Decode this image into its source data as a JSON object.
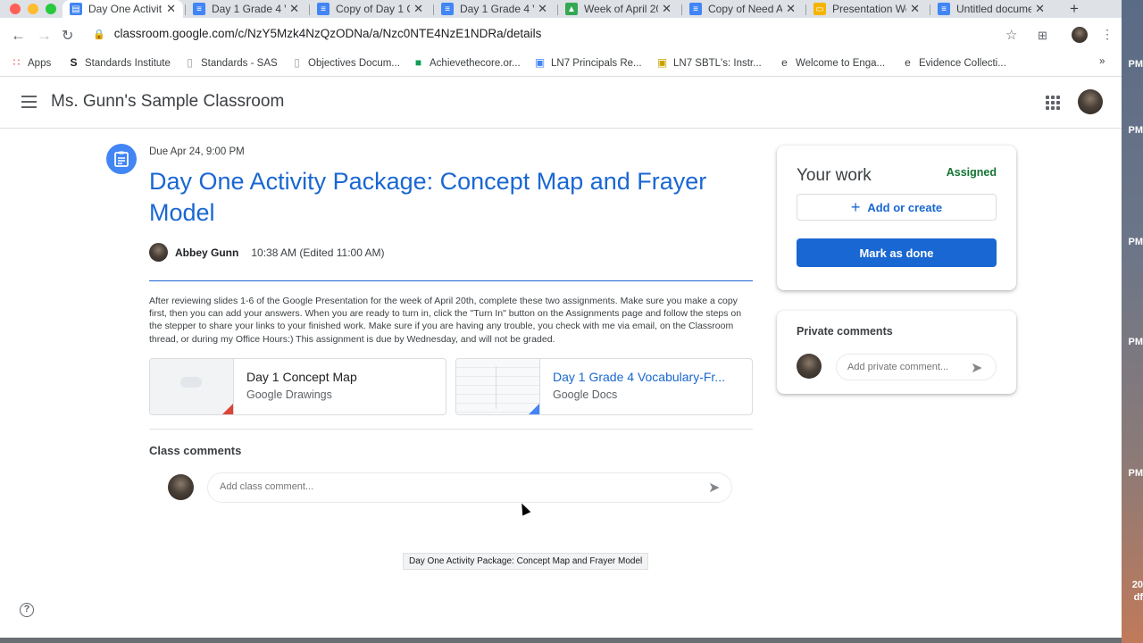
{
  "browser": {
    "tabs": [
      {
        "label": "Day One Activit",
        "icon": "classroom-icon",
        "color": "#4285f4",
        "active": true
      },
      {
        "label": "Day 1 Grade 4 V",
        "icon": "docs-icon",
        "color": "#4285f4"
      },
      {
        "label": "Copy of Day 1 C",
        "icon": "docs-icon",
        "color": "#4285f4"
      },
      {
        "label": "Day 1 Grade 4 V",
        "icon": "docs-icon",
        "color": "#4285f4"
      },
      {
        "label": "Week of April 20",
        "icon": "drive-icon",
        "color": "#34a853"
      },
      {
        "label": "Copy of Need A",
        "icon": "docs-icon",
        "color": "#4285f4"
      },
      {
        "label": "Presentation We",
        "icon": "slides-icon",
        "color": "#f4b400"
      },
      {
        "label": "Untitled docume",
        "icon": "docs-icon",
        "color": "#4285f4"
      }
    ],
    "new_tab": "+",
    "url": "classroom.google.com/c/NzY5Mzk4NzQzODNa/a/Nzc0NTE4NzE1NDRa/details",
    "bookmarks": [
      {
        "label": "Apps",
        "icon": "apps-grid-icon"
      },
      {
        "label": "Standards Institute",
        "icon": "s-logo-icon"
      },
      {
        "label": "Standards - SAS",
        "icon": "page-icon"
      },
      {
        "label": "Objectives Docum...",
        "icon": "page-icon"
      },
      {
        "label": "Achievethecore.or...",
        "icon": "green-square-icon"
      },
      {
        "label": "LN7 Principals Re...",
        "icon": "classroom-icon"
      },
      {
        "label": "LN7 SBTL's: Instr...",
        "icon": "yellow-board-icon"
      },
      {
        "label": "Welcome to Enga...",
        "icon": "engage-icon"
      },
      {
        "label": "Evidence Collecti...",
        "icon": "engage-icon"
      }
    ],
    "bookmarks_more": "»"
  },
  "appbar": {
    "class_name": "Ms. Gunn's Sample Classroom"
  },
  "assignment": {
    "due": "Due Apr 24, 9:00 PM",
    "title": "Day One Activity Package: Concept Map and Frayer Model",
    "author": "Abbey Gunn",
    "time": "10:38 AM (Edited 11:00 AM)",
    "description": "After reviewing slides 1-6 of the Google Presentation for the week of April 20th, complete these two assignments. Make sure you make a copy first, then you can add your answers. When you are ready to turn in, click the \"Turn In\" button on the Assignments page and follow the steps on the stepper to share your links to your finished work. Make sure if you are having any trouble, you check with me via email, on the Classroom thread, or during my Office Hours:) This assignment is due by Wednesday, and will not be graded.",
    "attachments": [
      {
        "title": "Day 1 Concept Map",
        "type": "Google Drawings",
        "accent": "#db4437"
      },
      {
        "title": "Day 1 Grade 4 Vocabulary-Fr...",
        "type": "Google Docs",
        "accent": "#4285f4"
      }
    ],
    "class_comments_label": "Class comments",
    "class_comment_placeholder": "Add class comment...",
    "tooltip": "Day One Activity Package: Concept Map and Frayer Model"
  },
  "your_work": {
    "title": "Your work",
    "status": "Assigned",
    "add_label": "Add or create",
    "done_label": "Mark as done"
  },
  "private_comments": {
    "title": "Private comments",
    "placeholder": "Add private comment..."
  },
  "desktop_clock_fragments": [
    "PM",
    "PM",
    "PM",
    "PM",
    "PM",
    "20",
    "df"
  ],
  "help_glyph": "?"
}
